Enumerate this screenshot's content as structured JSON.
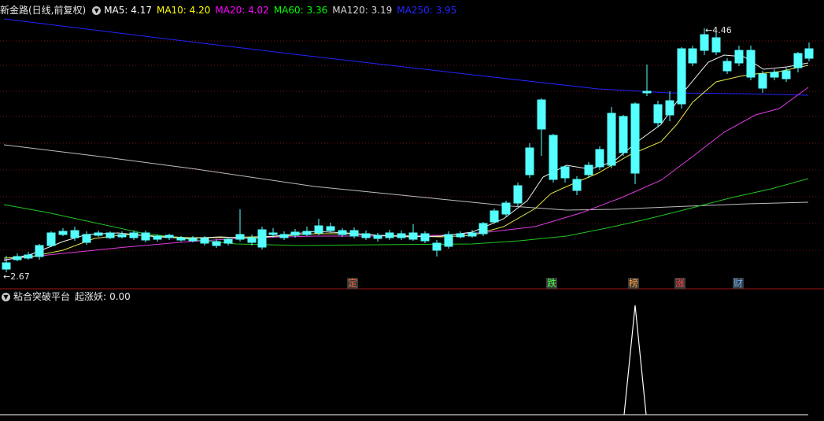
{
  "header": {
    "stock_title": "新金路(日线,前复权)",
    "ma": [
      {
        "label": "MA5:",
        "value": "4.17",
        "color": "#ffffff"
      },
      {
        "label": "MA10:",
        "value": "4.20",
        "color": "#ffff00"
      },
      {
        "label": "MA20:",
        "value": "4.02",
        "color": "#ff00ff"
      },
      {
        "label": "MA60:",
        "value": "3.36",
        "color": "#00ff00"
      },
      {
        "label": "MA120:",
        "value": "3.19",
        "color": "#d8d8d8"
      },
      {
        "label": "MA250:",
        "value": "3.95",
        "color": "#2424ff"
      }
    ]
  },
  "price_labels": {
    "high": "4.46",
    "low": "2.67"
  },
  "events": [
    {
      "label": "定",
      "color": "#ff6a3c"
    },
    {
      "label": "跌",
      "color": "#44ff44"
    },
    {
      "label": "榜",
      "color": "#ff9b3c"
    },
    {
      "label": "涨",
      "color": "#ff4040"
    },
    {
      "label": "财",
      "color": "#66b0ff"
    }
  ],
  "indicator": {
    "name": "粘合突破平台",
    "series_label": "起涨妖:",
    "series_value": "0.00"
  },
  "colors": {
    "up": "#ff3232",
    "down": "#54ffff",
    "grid": "#7a1010"
  }
}
